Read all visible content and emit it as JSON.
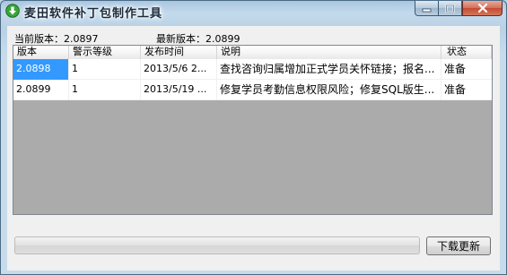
{
  "window": {
    "title": "麦田软件补丁包制作工具",
    "icon": "download-arrow-icon"
  },
  "versions": {
    "current_label": "当前版本：2.0897",
    "latest_label": "最新版本：2.0899"
  },
  "table": {
    "columns": [
      "版本",
      "警示等级",
      "发布时间",
      "说明",
      "状态"
    ],
    "rows": [
      [
        "2.0898",
        "1",
        "2013/5/6 2...",
        "查找咨询归属增加正式学员关怀链接；报名...",
        "准备"
      ],
      [
        "2.0899",
        "1",
        "2013/5/19 ...",
        "修复学员考勤信息权限风险；修复SQL版生...",
        "准备"
      ]
    ]
  },
  "progress": {
    "value": 0
  },
  "download_button": "下载更新"
}
